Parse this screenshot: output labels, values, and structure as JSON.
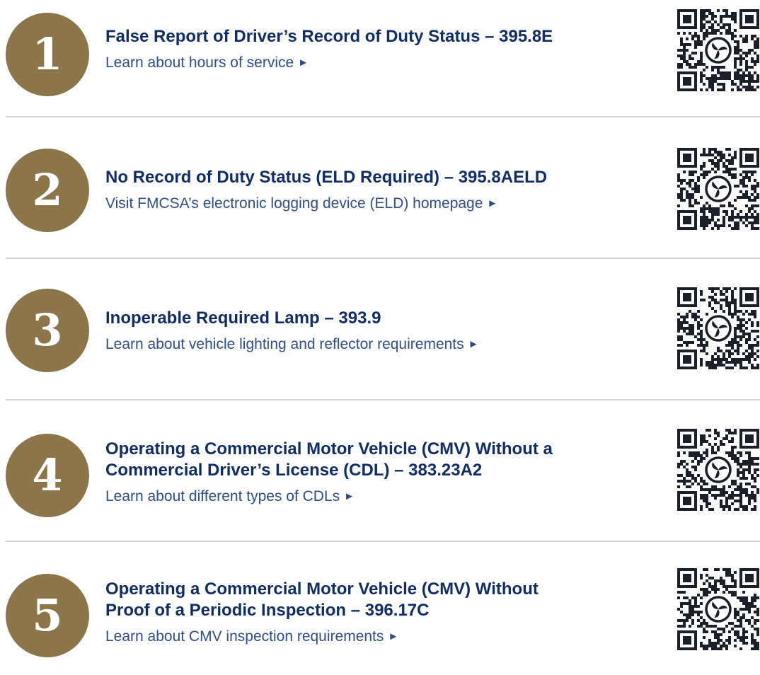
{
  "colors": {
    "badge": "#8c7549",
    "title": "#102e66",
    "link": "#2f4d8a",
    "divider": "#d2d3d5",
    "qr_dark": "#1b1f2a"
  },
  "items": [
    {
      "number": "1",
      "title_lines": [
        "False Report of Driver’s Record of Duty Status – 395.8E"
      ],
      "link_text": "Learn about hours of service",
      "link_icon": "right-triangle-icon",
      "qr_icon": "qr-code-icon"
    },
    {
      "number": "2",
      "title_lines": [
        "No Record of Duty Status (ELD Required) – 395.8AELD"
      ],
      "link_text": "Visit FMCSA’s electronic logging device (ELD) homepage",
      "link_icon": "right-triangle-icon",
      "qr_icon": "qr-code-icon"
    },
    {
      "number": "3",
      "title_lines": [
        "Inoperable Required Lamp – 393.9"
      ],
      "link_text": "Learn about vehicle lighting and reflector requirements",
      "link_icon": "right-triangle-icon",
      "qr_icon": "qr-code-icon"
    },
    {
      "number": "4",
      "title_lines": [
        "Operating a Commercial Motor Vehicle (CMV) Without a",
        "Commercial Driver’s License (CDL) – 383.23A2"
      ],
      "link_text": "Learn about different types of CDLs",
      "link_icon": "right-triangle-icon",
      "qr_icon": "qr-code-icon"
    },
    {
      "number": "5",
      "title_lines": [
        "Operating a Commercial Motor Vehicle (CMV) Without",
        "Proof of a Periodic Inspection – 396.17C"
      ],
      "link_text": "Learn about CMV inspection requirements",
      "link_icon": "right-triangle-icon",
      "qr_icon": "qr-code-icon"
    }
  ]
}
